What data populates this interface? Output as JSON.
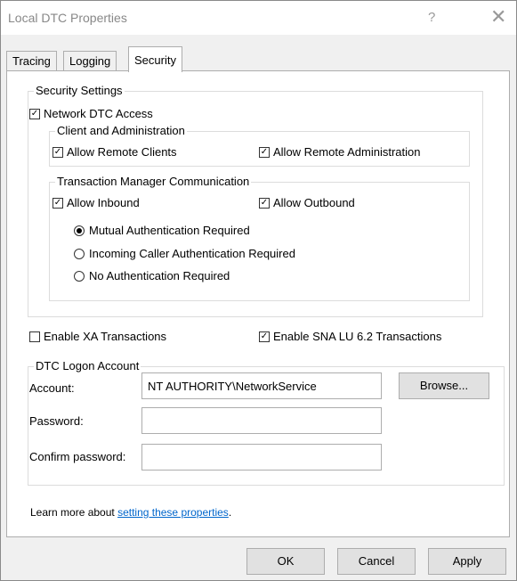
{
  "window": {
    "title": "Local DTC Properties",
    "help_glyph": "?",
    "close_glyph": "✕"
  },
  "tabs": [
    {
      "label": "Tracing"
    },
    {
      "label": "Logging"
    },
    {
      "label": "Security"
    }
  ],
  "security": {
    "group_label": "Security Settings",
    "network_dtc_access": {
      "label": "Network DTC Access",
      "checked": true
    },
    "client_admin": {
      "group_label": "Client and Administration",
      "allow_remote_clients": {
        "label": "Allow Remote Clients",
        "checked": true
      },
      "allow_remote_admin": {
        "label": "Allow Remote Administration",
        "checked": true
      }
    },
    "tm_comm": {
      "group_label": "Transaction Manager Communication",
      "allow_inbound": {
        "label": "Allow Inbound",
        "checked": true
      },
      "allow_outbound": {
        "label": "Allow Outbound",
        "checked": true
      },
      "auth_options": [
        {
          "label": "Mutual Authentication Required",
          "selected": true
        },
        {
          "label": "Incoming Caller Authentication Required",
          "selected": false
        },
        {
          "label": "No Authentication Required",
          "selected": false
        }
      ]
    },
    "enable_xa": {
      "label": "Enable XA Transactions",
      "checked": false
    },
    "enable_sna": {
      "label": "Enable SNA LU 6.2 Transactions",
      "checked": true
    }
  },
  "logon": {
    "group_label": "DTC Logon Account",
    "account_label": "Account:",
    "account_value": "NT AUTHORITY\\NetworkService",
    "browse_label": "Browse...",
    "password_label": "Password:",
    "password_value": "",
    "confirm_label": "Confirm password:",
    "confirm_value": ""
  },
  "learn_more": {
    "prefix": "Learn more about ",
    "link_text": "setting these properties",
    "suffix": "."
  },
  "footer": {
    "ok": "OK",
    "cancel": "Cancel",
    "apply": "Apply"
  }
}
